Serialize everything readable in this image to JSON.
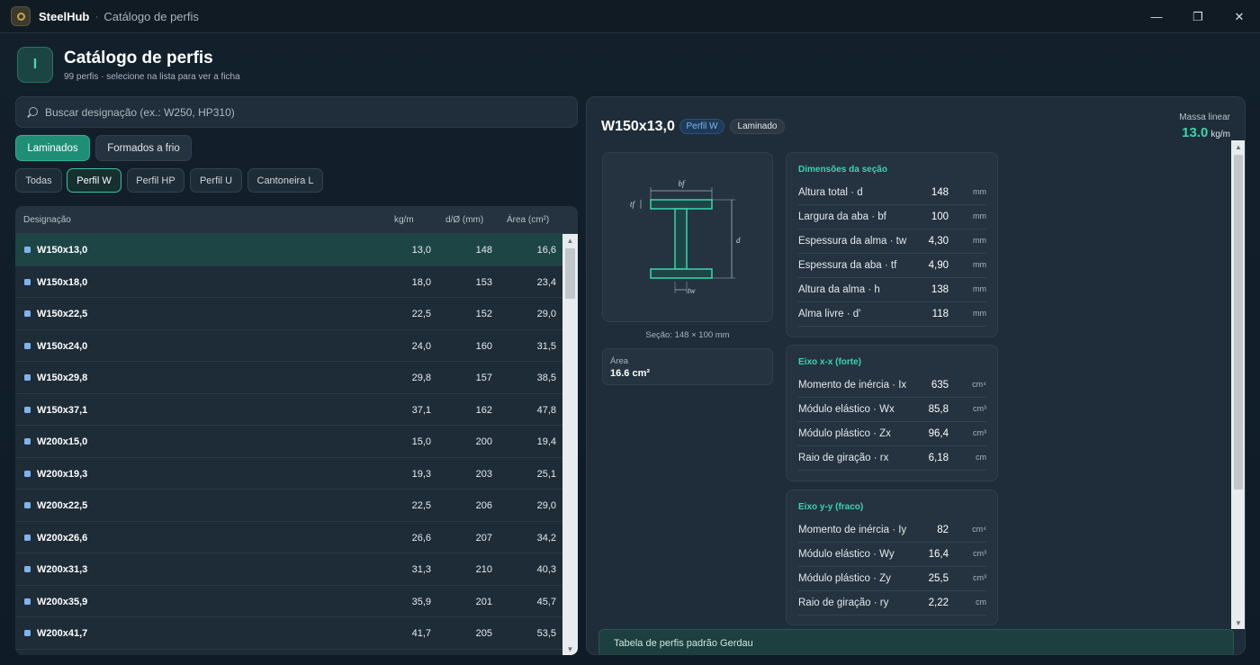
{
  "window": {
    "app_name": "SteelHub",
    "separator": "·",
    "title": "Catálogo de perfis",
    "controls": [
      "—",
      "❐",
      "✕"
    ]
  },
  "header": {
    "title": "Catálogo de perfis",
    "subtitle": "99 perfis · selecione na lista para ver a ficha",
    "icon": "i-beam-icon",
    "icon_glyph": "I"
  },
  "search": {
    "placeholder": "Buscar designação (ex.: W250, HP310)",
    "value": ""
  },
  "tabs": [
    {
      "label": "Laminados",
      "active": true
    },
    {
      "label": "Formados a frio",
      "active": false
    }
  ],
  "filters": [
    {
      "label": "Todas",
      "active": false
    },
    {
      "label": "Perfil W",
      "active": true
    },
    {
      "label": "Perfil HP",
      "active": false
    },
    {
      "label": "Perfil U",
      "active": false
    },
    {
      "label": "Cantoneira L",
      "active": false
    }
  ],
  "table": {
    "columns": [
      "Designação",
      "kg/m",
      "d/Ø (mm)",
      "Área (cm²)"
    ],
    "rows": [
      {
        "name": "W150x13,0",
        "kgm": "13,0",
        "d": "148",
        "area": "16,6",
        "selected": true
      },
      {
        "name": "W150x18,0",
        "kgm": "18,0",
        "d": "153",
        "area": "23,4"
      },
      {
        "name": "W150x22,5",
        "kgm": "22,5",
        "d": "152",
        "area": "29,0"
      },
      {
        "name": "W150x24,0",
        "kgm": "24,0",
        "d": "160",
        "area": "31,5"
      },
      {
        "name": "W150x29,8",
        "kgm": "29,8",
        "d": "157",
        "area": "38,5"
      },
      {
        "name": "W150x37,1",
        "kgm": "37,1",
        "d": "162",
        "area": "47,8"
      },
      {
        "name": "W200x15,0",
        "kgm": "15,0",
        "d": "200",
        "area": "19,4"
      },
      {
        "name": "W200x19,3",
        "kgm": "19,3",
        "d": "203",
        "area": "25,1"
      },
      {
        "name": "W200x22,5",
        "kgm": "22,5",
        "d": "206",
        "area": "29,0"
      },
      {
        "name": "W200x26,6",
        "kgm": "26,6",
        "d": "207",
        "area": "34,2"
      },
      {
        "name": "W200x31,3",
        "kgm": "31,3",
        "d": "210",
        "area": "40,3"
      },
      {
        "name": "W200x35,9",
        "kgm": "35,9",
        "d": "201",
        "area": "45,7"
      },
      {
        "name": "W200x41,7",
        "kgm": "41,7",
        "d": "205",
        "area": "53,5"
      }
    ]
  },
  "detail": {
    "title": "W150x13,0",
    "badges": [
      "Perfil W",
      "Laminado"
    ],
    "mass": {
      "label": "Massa linear",
      "value": "13.0",
      "unit": "kg/m"
    },
    "drawing": {
      "labels": {
        "bf": "bf",
        "tf": "tf",
        "d": "d",
        "tw": "tw"
      },
      "caption": "Seção: 148 × 100 mm"
    },
    "area": {
      "label": "Área",
      "value": "16.6 cm²"
    },
    "sections": [
      {
        "title": "Dimensões da seção",
        "rows": [
          {
            "label": "Altura total · d",
            "value": "148",
            "unit": "mm"
          },
          {
            "label": "Largura da aba · bf",
            "value": "100",
            "unit": "mm"
          },
          {
            "label": "Espessura da alma · tw",
            "value": "4,30",
            "unit": "mm"
          },
          {
            "label": "Espessura da aba · tf",
            "value": "4,90",
            "unit": "mm"
          },
          {
            "label": "Altura da alma · h",
            "value": "138",
            "unit": "mm"
          },
          {
            "label": "Alma livre · d'",
            "value": "118",
            "unit": "mm"
          }
        ]
      },
      {
        "title": "Eixo x-x (forte)",
        "rows": [
          {
            "label": "Momento de inércia · Ix",
            "value": "635",
            "unit": "cm⁴"
          },
          {
            "label": "Módulo elástico · Wx",
            "value": "85,8",
            "unit": "cm³"
          },
          {
            "label": "Módulo plástico · Zx",
            "value": "96,4",
            "unit": "cm³"
          },
          {
            "label": "Raio de giração · rx",
            "value": "6,18",
            "unit": "cm"
          }
        ]
      },
      {
        "title": "Eixo y-y (fraco)",
        "rows": [
          {
            "label": "Momento de inércia · Iy",
            "value": "82",
            "unit": "cm⁴"
          },
          {
            "label": "Módulo elástico · Wy",
            "value": "16,4",
            "unit": "cm³"
          },
          {
            "label": "Módulo plástico · Zy",
            "value": "25,5",
            "unit": "cm³"
          },
          {
            "label": "Raio de giração · ry",
            "value": "2,22",
            "unit": "cm"
          }
        ]
      }
    ],
    "footer": "Tabela de perfis padrão Gerdau"
  },
  "scrollbars": {
    "up": "▲",
    "down": "▼"
  },
  "colors": {
    "accent": "#3dd3b0",
    "tab_active": "#1f8e76",
    "selected_row": "#1e4545",
    "badge_w": "#7db6ec"
  }
}
